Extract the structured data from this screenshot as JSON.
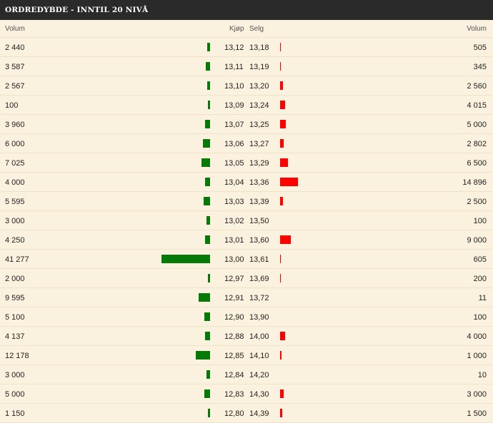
{
  "title": "ORDREDYBDE - INNTIL 20 NIVÅ",
  "columns": {
    "buy_volume": "Volum",
    "buy_price": "Kjøp",
    "sell_price": "Selg",
    "sell_volume": "Volum"
  },
  "colors": {
    "buy_bar": "#067a06",
    "sell_bar": "#ff0000",
    "background": "#fbf1df",
    "titlebar": "#2a2a2a"
  },
  "rows": [
    {
      "buy_volume": "2 440",
      "buy_price": "13,12",
      "sell_price": "13,18",
      "sell_volume": "505"
    },
    {
      "buy_volume": "3 587",
      "buy_price": "13,11",
      "sell_price": "13,19",
      "sell_volume": "345"
    },
    {
      "buy_volume": "2 567",
      "buy_price": "13,10",
      "sell_price": "13,20",
      "sell_volume": "2 560"
    },
    {
      "buy_volume": "100",
      "buy_price": "13,09",
      "sell_price": "13,24",
      "sell_volume": "4 015"
    },
    {
      "buy_volume": "3 960",
      "buy_price": "13,07",
      "sell_price": "13,25",
      "sell_volume": "5 000"
    },
    {
      "buy_volume": "6 000",
      "buy_price": "13,06",
      "sell_price": "13,27",
      "sell_volume": "2 802"
    },
    {
      "buy_volume": "7 025",
      "buy_price": "13,05",
      "sell_price": "13,29",
      "sell_volume": "6 500"
    },
    {
      "buy_volume": "4 000",
      "buy_price": "13,04",
      "sell_price": "13,36",
      "sell_volume": "14 896"
    },
    {
      "buy_volume": "5 595",
      "buy_price": "13,03",
      "sell_price": "13,39",
      "sell_volume": "2 500"
    },
    {
      "buy_volume": "3 000",
      "buy_price": "13,02",
      "sell_price": "13,50",
      "sell_volume": "100"
    },
    {
      "buy_volume": "4 250",
      "buy_price": "13,01",
      "sell_price": "13,60",
      "sell_volume": "9 000"
    },
    {
      "buy_volume": "41 277",
      "buy_price": "13,00",
      "sell_price": "13,61",
      "sell_volume": "605"
    },
    {
      "buy_volume": "2 000",
      "buy_price": "12,97",
      "sell_price": "13,69",
      "sell_volume": "200"
    },
    {
      "buy_volume": "9 595",
      "buy_price": "12,91",
      "sell_price": "13,72",
      "sell_volume": "11"
    },
    {
      "buy_volume": "5 100",
      "buy_price": "12,90",
      "sell_price": "13,90",
      "sell_volume": "100"
    },
    {
      "buy_volume": "4 137",
      "buy_price": "12,88",
      "sell_price": "14,00",
      "sell_volume": "4 000"
    },
    {
      "buy_volume": "12 178",
      "buy_price": "12,85",
      "sell_price": "14,10",
      "sell_volume": "1 000"
    },
    {
      "buy_volume": "3 000",
      "buy_price": "12,84",
      "sell_price": "14,20",
      "sell_volume": "10"
    },
    {
      "buy_volume": "5 000",
      "buy_price": "12,83",
      "sell_price": "14,30",
      "sell_volume": "3 000"
    },
    {
      "buy_volume": "1 150",
      "buy_price": "12,80",
      "sell_price": "14,39",
      "sell_volume": "1 500"
    }
  ]
}
